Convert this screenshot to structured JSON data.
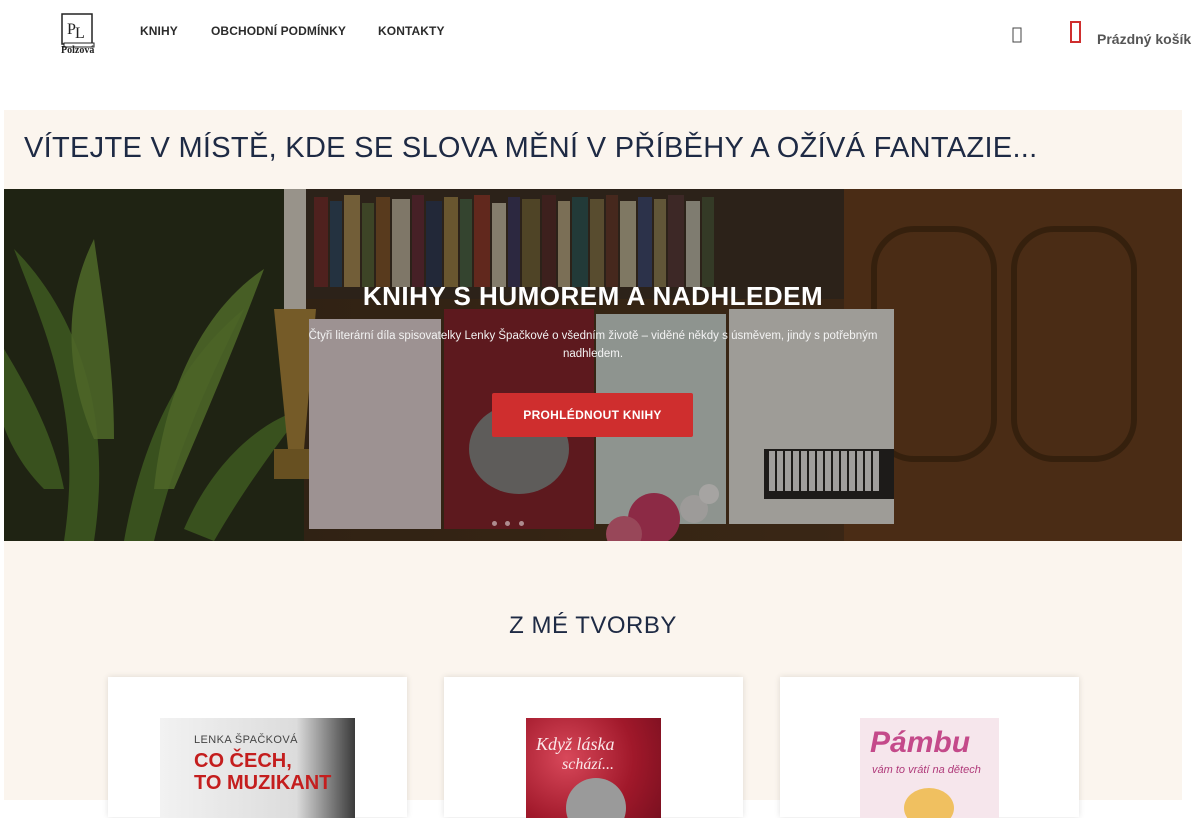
{
  "header": {
    "logo_text": "Polzová",
    "nav": [
      {
        "label": "KNIHY"
      },
      {
        "label": "OBCHODNÍ PODMÍNKY"
      },
      {
        "label": "KONTAKTY"
      }
    ],
    "cart_label": "Prázdný košík",
    "icons": {
      "search": "search-icon",
      "cart": "shopping-bag-icon"
    },
    "accent_color": "#cf2e2e"
  },
  "welcome": {
    "headline": "VÍTEJTE V MÍSTĚ, KDE SE SLOVA MĚNÍ V PŘÍBĚHY A OŽÍVÁ FANTAZIE..."
  },
  "hero": {
    "title": "KNIHY S HUMOREM A NADHLEDEM",
    "subtitle": "Čtyři literární díla spisovatelky Lenky Špačkové o všedním životě – viděné někdy s úsměvem, jindy s potřebným nadhledem.",
    "button_label": "PROHLÉDNOUT KNIHY",
    "slide_count": 3
  },
  "works": {
    "heading": "Z MÉ TVORBY",
    "books": [
      {
        "author": "LENKA ŠPAČKOVÁ",
        "title_line1": "CO ČECH,",
        "title_line2": "TO MUZIKANT"
      },
      {
        "author": "",
        "title_line1": "Když láska",
        "title_line2": "schází..."
      },
      {
        "author": "",
        "title_line1": "Pámbu",
        "title_line2": "vám to vrátí na dětech"
      }
    ]
  },
  "colors": {
    "section_bg": "#fbf5ee",
    "heading_text": "#1e2a44",
    "button": "#cf2e2e"
  }
}
